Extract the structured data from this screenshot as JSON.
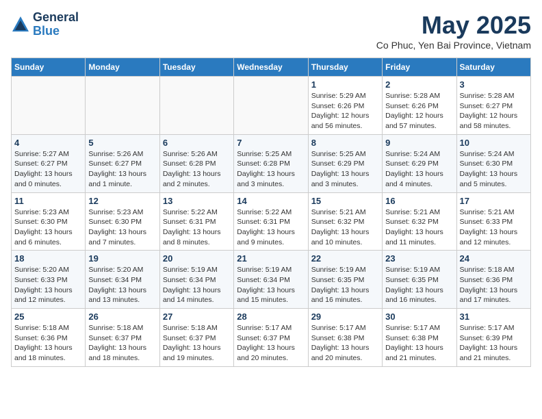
{
  "header": {
    "logo_general": "General",
    "logo_blue": "Blue",
    "month": "May 2025",
    "location": "Co Phuc, Yen Bai Province, Vietnam"
  },
  "weekdays": [
    "Sunday",
    "Monday",
    "Tuesday",
    "Wednesday",
    "Thursday",
    "Friday",
    "Saturday"
  ],
  "weeks": [
    [
      {
        "day": "",
        "info": ""
      },
      {
        "day": "",
        "info": ""
      },
      {
        "day": "",
        "info": ""
      },
      {
        "day": "",
        "info": ""
      },
      {
        "day": "1",
        "info": "Sunrise: 5:29 AM\nSunset: 6:26 PM\nDaylight: 12 hours and 56 minutes."
      },
      {
        "day": "2",
        "info": "Sunrise: 5:28 AM\nSunset: 6:26 PM\nDaylight: 12 hours and 57 minutes."
      },
      {
        "day": "3",
        "info": "Sunrise: 5:28 AM\nSunset: 6:27 PM\nDaylight: 12 hours and 58 minutes."
      }
    ],
    [
      {
        "day": "4",
        "info": "Sunrise: 5:27 AM\nSunset: 6:27 PM\nDaylight: 13 hours and 0 minutes."
      },
      {
        "day": "5",
        "info": "Sunrise: 5:26 AM\nSunset: 6:27 PM\nDaylight: 13 hours and 1 minute."
      },
      {
        "day": "6",
        "info": "Sunrise: 5:26 AM\nSunset: 6:28 PM\nDaylight: 13 hours and 2 minutes."
      },
      {
        "day": "7",
        "info": "Sunrise: 5:25 AM\nSunset: 6:28 PM\nDaylight: 13 hours and 3 minutes."
      },
      {
        "day": "8",
        "info": "Sunrise: 5:25 AM\nSunset: 6:29 PM\nDaylight: 13 hours and 3 minutes."
      },
      {
        "day": "9",
        "info": "Sunrise: 5:24 AM\nSunset: 6:29 PM\nDaylight: 13 hours and 4 minutes."
      },
      {
        "day": "10",
        "info": "Sunrise: 5:24 AM\nSunset: 6:30 PM\nDaylight: 13 hours and 5 minutes."
      }
    ],
    [
      {
        "day": "11",
        "info": "Sunrise: 5:23 AM\nSunset: 6:30 PM\nDaylight: 13 hours and 6 minutes."
      },
      {
        "day": "12",
        "info": "Sunrise: 5:23 AM\nSunset: 6:30 PM\nDaylight: 13 hours and 7 minutes."
      },
      {
        "day": "13",
        "info": "Sunrise: 5:22 AM\nSunset: 6:31 PM\nDaylight: 13 hours and 8 minutes."
      },
      {
        "day": "14",
        "info": "Sunrise: 5:22 AM\nSunset: 6:31 PM\nDaylight: 13 hours and 9 minutes."
      },
      {
        "day": "15",
        "info": "Sunrise: 5:21 AM\nSunset: 6:32 PM\nDaylight: 13 hours and 10 minutes."
      },
      {
        "day": "16",
        "info": "Sunrise: 5:21 AM\nSunset: 6:32 PM\nDaylight: 13 hours and 11 minutes."
      },
      {
        "day": "17",
        "info": "Sunrise: 5:21 AM\nSunset: 6:33 PM\nDaylight: 13 hours and 12 minutes."
      }
    ],
    [
      {
        "day": "18",
        "info": "Sunrise: 5:20 AM\nSunset: 6:33 PM\nDaylight: 13 hours and 12 minutes."
      },
      {
        "day": "19",
        "info": "Sunrise: 5:20 AM\nSunset: 6:34 PM\nDaylight: 13 hours and 13 minutes."
      },
      {
        "day": "20",
        "info": "Sunrise: 5:19 AM\nSunset: 6:34 PM\nDaylight: 13 hours and 14 minutes."
      },
      {
        "day": "21",
        "info": "Sunrise: 5:19 AM\nSunset: 6:34 PM\nDaylight: 13 hours and 15 minutes."
      },
      {
        "day": "22",
        "info": "Sunrise: 5:19 AM\nSunset: 6:35 PM\nDaylight: 13 hours and 16 minutes."
      },
      {
        "day": "23",
        "info": "Sunrise: 5:19 AM\nSunset: 6:35 PM\nDaylight: 13 hours and 16 minutes."
      },
      {
        "day": "24",
        "info": "Sunrise: 5:18 AM\nSunset: 6:36 PM\nDaylight: 13 hours and 17 minutes."
      }
    ],
    [
      {
        "day": "25",
        "info": "Sunrise: 5:18 AM\nSunset: 6:36 PM\nDaylight: 13 hours and 18 minutes."
      },
      {
        "day": "26",
        "info": "Sunrise: 5:18 AM\nSunset: 6:37 PM\nDaylight: 13 hours and 18 minutes."
      },
      {
        "day": "27",
        "info": "Sunrise: 5:18 AM\nSunset: 6:37 PM\nDaylight: 13 hours and 19 minutes."
      },
      {
        "day": "28",
        "info": "Sunrise: 5:17 AM\nSunset: 6:37 PM\nDaylight: 13 hours and 20 minutes."
      },
      {
        "day": "29",
        "info": "Sunrise: 5:17 AM\nSunset: 6:38 PM\nDaylight: 13 hours and 20 minutes."
      },
      {
        "day": "30",
        "info": "Sunrise: 5:17 AM\nSunset: 6:38 PM\nDaylight: 13 hours and 21 minutes."
      },
      {
        "day": "31",
        "info": "Sunrise: 5:17 AM\nSunset: 6:39 PM\nDaylight: 13 hours and 21 minutes."
      }
    ]
  ]
}
